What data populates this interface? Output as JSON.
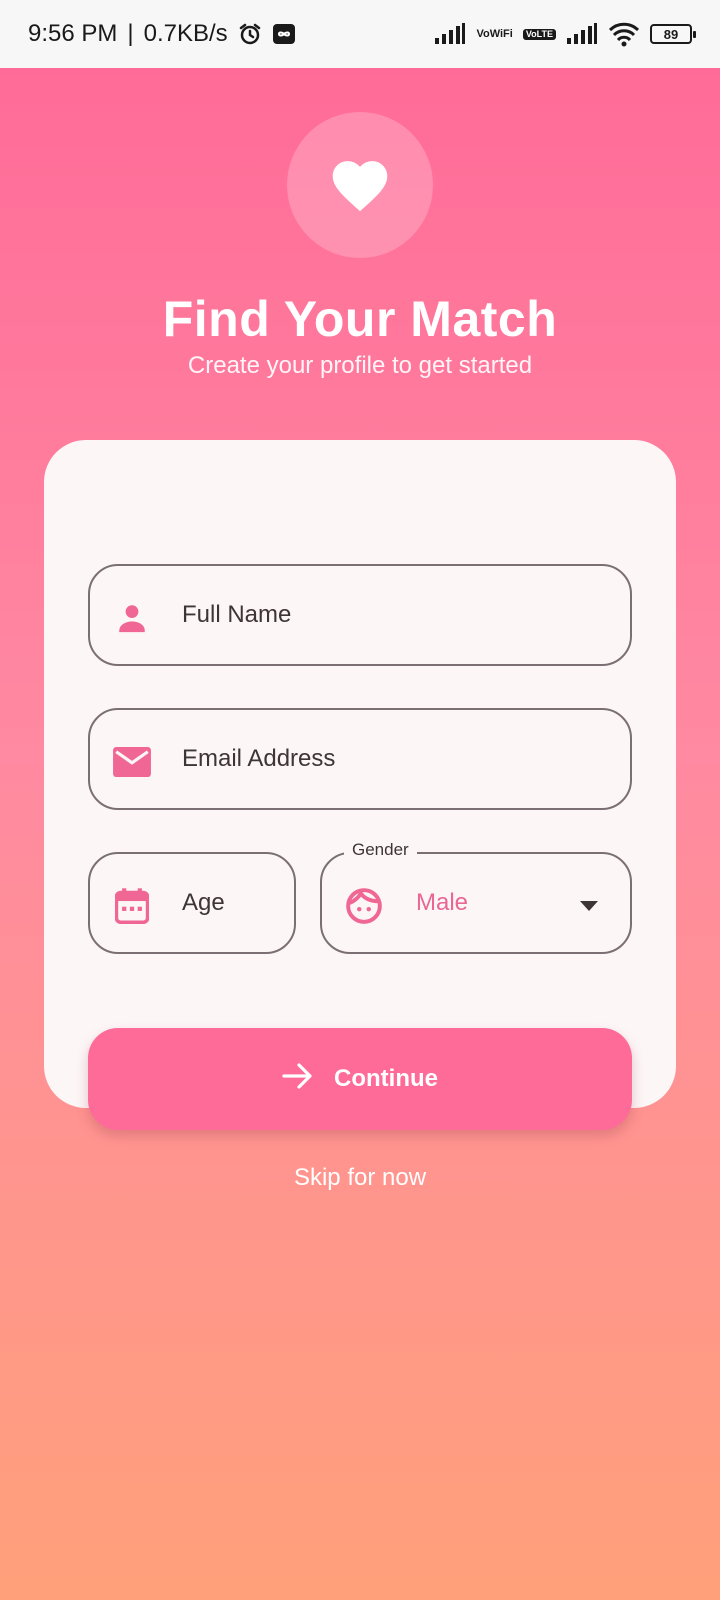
{
  "status_bar": {
    "time": "9:56 PM",
    "speed": "0.7KB/s",
    "vo_wifi_top": "Vo",
    "vo_wifi_bottom": "WiFi",
    "vo_lte_top": "Vo",
    "vo_lte_bottom": "LTE",
    "battery": "89"
  },
  "header": {
    "title": "Find Your Match",
    "subtitle": "Create your profile to get started"
  },
  "form": {
    "full_name_placeholder": "Full Name",
    "email_placeholder": "Email Address",
    "age_placeholder": "Age",
    "gender_label": "Gender",
    "gender_value": "Male"
  },
  "actions": {
    "continue_label": "Continue",
    "skip_label": "Skip for now"
  },
  "colors": {
    "accent": "#ff6b98",
    "gradient_end": "#ffa07a",
    "card": "#fdf6f7"
  }
}
